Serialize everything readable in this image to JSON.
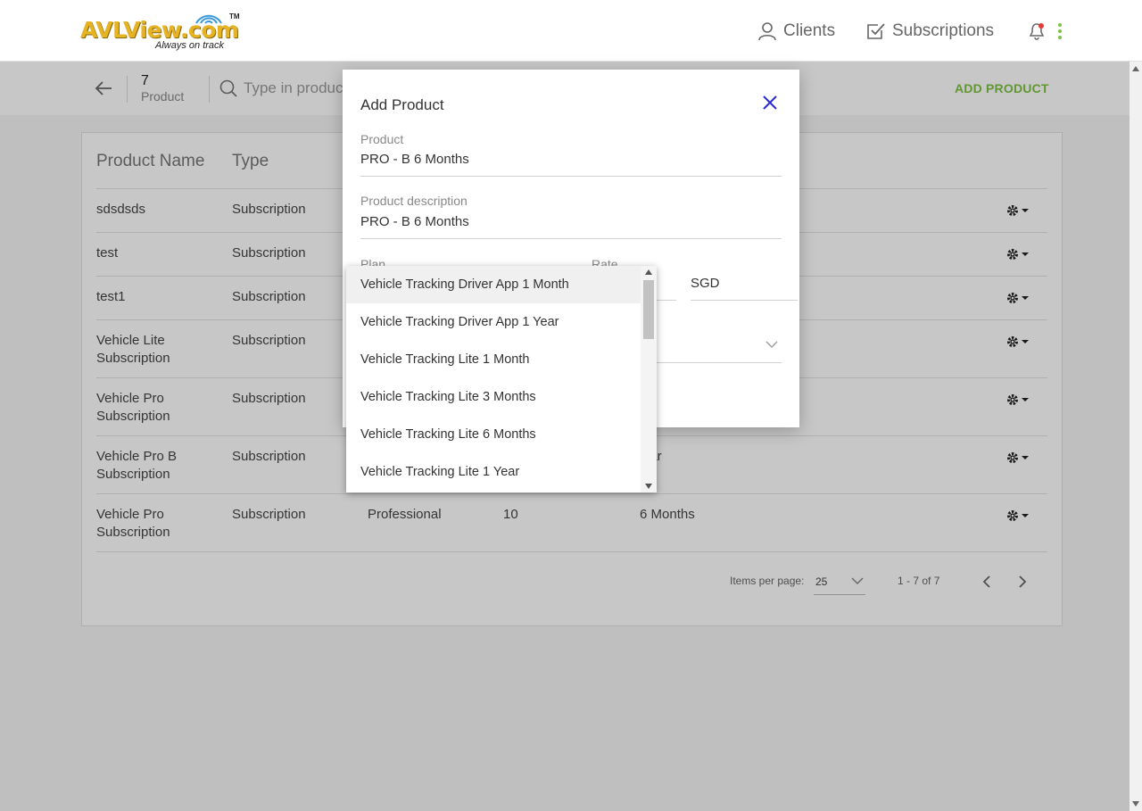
{
  "header": {
    "logo_text": "AVLView.com",
    "logo_tm": "TM",
    "logo_tagline": "Always on track",
    "nav_clients": "Clients",
    "nav_subscriptions": "Subscriptions",
    "accent_color": "#7dc242",
    "notification_dot_color": "#e53935"
  },
  "toolbar": {
    "count": "7",
    "count_label": "Product",
    "search_placeholder": "Type in product name",
    "add_product_label": "ADD PRODUCT"
  },
  "table": {
    "headers": [
      "Product Name",
      "Type"
    ],
    "rows": [
      {
        "name": "sdsdsds",
        "type": "Subscription",
        "col3": "",
        "col4": "",
        "col5": ""
      },
      {
        "name": "test",
        "type": "Subscription",
        "col3": "",
        "col4": "",
        "col5": ""
      },
      {
        "name": "test1",
        "type": "Subscription",
        "col3": "",
        "col4": "",
        "col5": ""
      },
      {
        "name": "Vehicle Lite Subscription",
        "type": "Subscription",
        "col3": "",
        "col4": "",
        "col5": ""
      },
      {
        "name": "Vehicle Pro Subscription",
        "type": "Subscription",
        "col3": "",
        "col4": "",
        "col5": ""
      },
      {
        "name": "Vehicle Pro B Subscription",
        "type": "Subscription",
        "col3": "",
        "col4": "",
        "col5": "ear"
      },
      {
        "name": "Vehicle Pro Subscription",
        "type": "Subscription",
        "col3": "Professional",
        "col4": "10",
        "col5": "6 Months"
      }
    ]
  },
  "pagination": {
    "items_per_page_label": "Items per page:",
    "items_per_page_value": "25",
    "range_label": "1 - 7 of 7"
  },
  "dialog": {
    "title": "Add Product",
    "product_label": "Product",
    "product_value": "PRO - B 6 Months",
    "description_label": "Product description",
    "description_value": "PRO - B 6 Months",
    "plan_label": "Plan",
    "rate_label": "Rate",
    "currency_value": "SGD"
  },
  "plan_dropdown": {
    "options": [
      "Vehicle Tracking Driver App 1 Month",
      "Vehicle Tracking Driver App 1 Year",
      "Vehicle Tracking Lite 1 Month",
      "Vehicle Tracking Lite 3 Months",
      "Vehicle Tracking Lite 6 Months",
      "Vehicle Tracking Lite 1 Year"
    ],
    "highlighted_index": 0
  }
}
